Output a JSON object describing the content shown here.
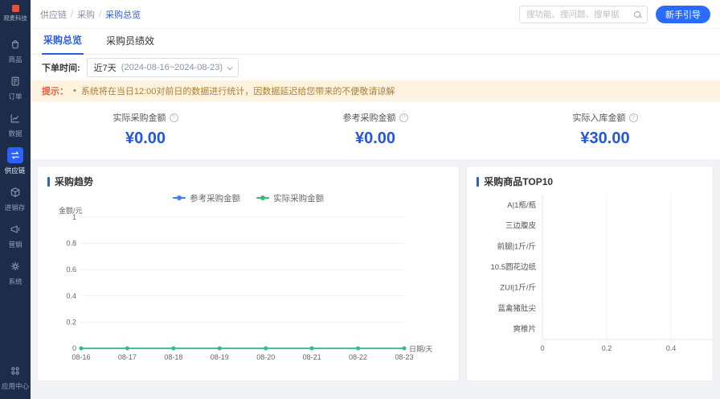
{
  "colors": {
    "accent": "#2b5fd9",
    "sidebar_bg": "#1d2c4a",
    "sidebar_active": "#2b62ff",
    "metric_value": "#2456d9",
    "notice_bg": "#fdf3df"
  },
  "sidebar": {
    "logo": "观麦科技",
    "items": [
      {
        "key": "goods",
        "label": "商品",
        "active": false
      },
      {
        "key": "orders",
        "label": "订单",
        "active": false
      },
      {
        "key": "data",
        "label": "数据",
        "active": false
      },
      {
        "key": "supply-chain",
        "label": "供应链",
        "active": true
      },
      {
        "key": "inventory",
        "label": "进销存",
        "active": false
      },
      {
        "key": "marketing",
        "label": "营销",
        "active": false
      },
      {
        "key": "system",
        "label": "系统",
        "active": false
      }
    ],
    "app_center": "应用中心"
  },
  "header": {
    "breadcrumb": [
      "供应链",
      "采购",
      "采购总览"
    ],
    "search_placeholder": "搜功能、搜问题、搜单据",
    "guide_button": "新手引导"
  },
  "tabs": [
    {
      "key": "purchase-overview",
      "label": "采购总览",
      "active": true
    },
    {
      "key": "buyer-performance",
      "label": "采购员绩效",
      "active": false
    }
  ],
  "filter": {
    "label": "下单时间:",
    "value": "近7天",
    "range": "(2024-08-16~2024-08-23)"
  },
  "notice": {
    "prefix": "提示：",
    "bullet": "•",
    "text": "系统将在当日12:00对前日的数据进行统计，因数据延迟给您带来的不便敬请谅解"
  },
  "metrics": [
    {
      "key": "actual-purchase",
      "label": "实际采购金额",
      "value": "¥0.00"
    },
    {
      "key": "reference-purchase",
      "label": "参考采购金额",
      "value": "¥0.00"
    },
    {
      "key": "actual-inbound",
      "label": "实际入库金额",
      "value": "¥30.00"
    }
  ],
  "chart_data": [
    {
      "type": "line",
      "title": "采购趋势",
      "x": [
        "08-16",
        "08-17",
        "08-18",
        "08-19",
        "08-20",
        "08-21",
        "08-22",
        "08-23"
      ],
      "series": [
        {
          "name": "参考采购金额",
          "color": "#3f7dfa",
          "values": [
            0,
            0,
            0,
            0,
            0,
            0,
            0,
            0
          ]
        },
        {
          "name": "实际采购金额",
          "color": "#30bf78",
          "values": [
            0,
            0,
            0,
            0,
            0,
            0,
            0,
            0
          ]
        }
      ],
      "ylabel": "金额/元",
      "xlabel": "日期/天",
      "ylim": [
        0,
        1
      ],
      "yticks": [
        0,
        0.2,
        0.4,
        0.6,
        0.8,
        1
      ],
      "grid": true,
      "legend_position": "top-center"
    },
    {
      "type": "bar-horizontal",
      "title": "采购商品TOP10",
      "categories": [
        "A|1瓶/瓶",
        "三边腹皮",
        "前腿|1斤/斤",
        "10.5圆花边纸",
        "ZUI|1斤/斤",
        "蓝禽猪肚尖",
        "爽椎片"
      ],
      "values": [
        0,
        0,
        0,
        0,
        0,
        0,
        0
      ],
      "bar_color": "#3f7dfa",
      "xticks": [
        0,
        0.2,
        0.4
      ],
      "xlim": [
        0,
        0.62
      ],
      "grid": true
    }
  ]
}
